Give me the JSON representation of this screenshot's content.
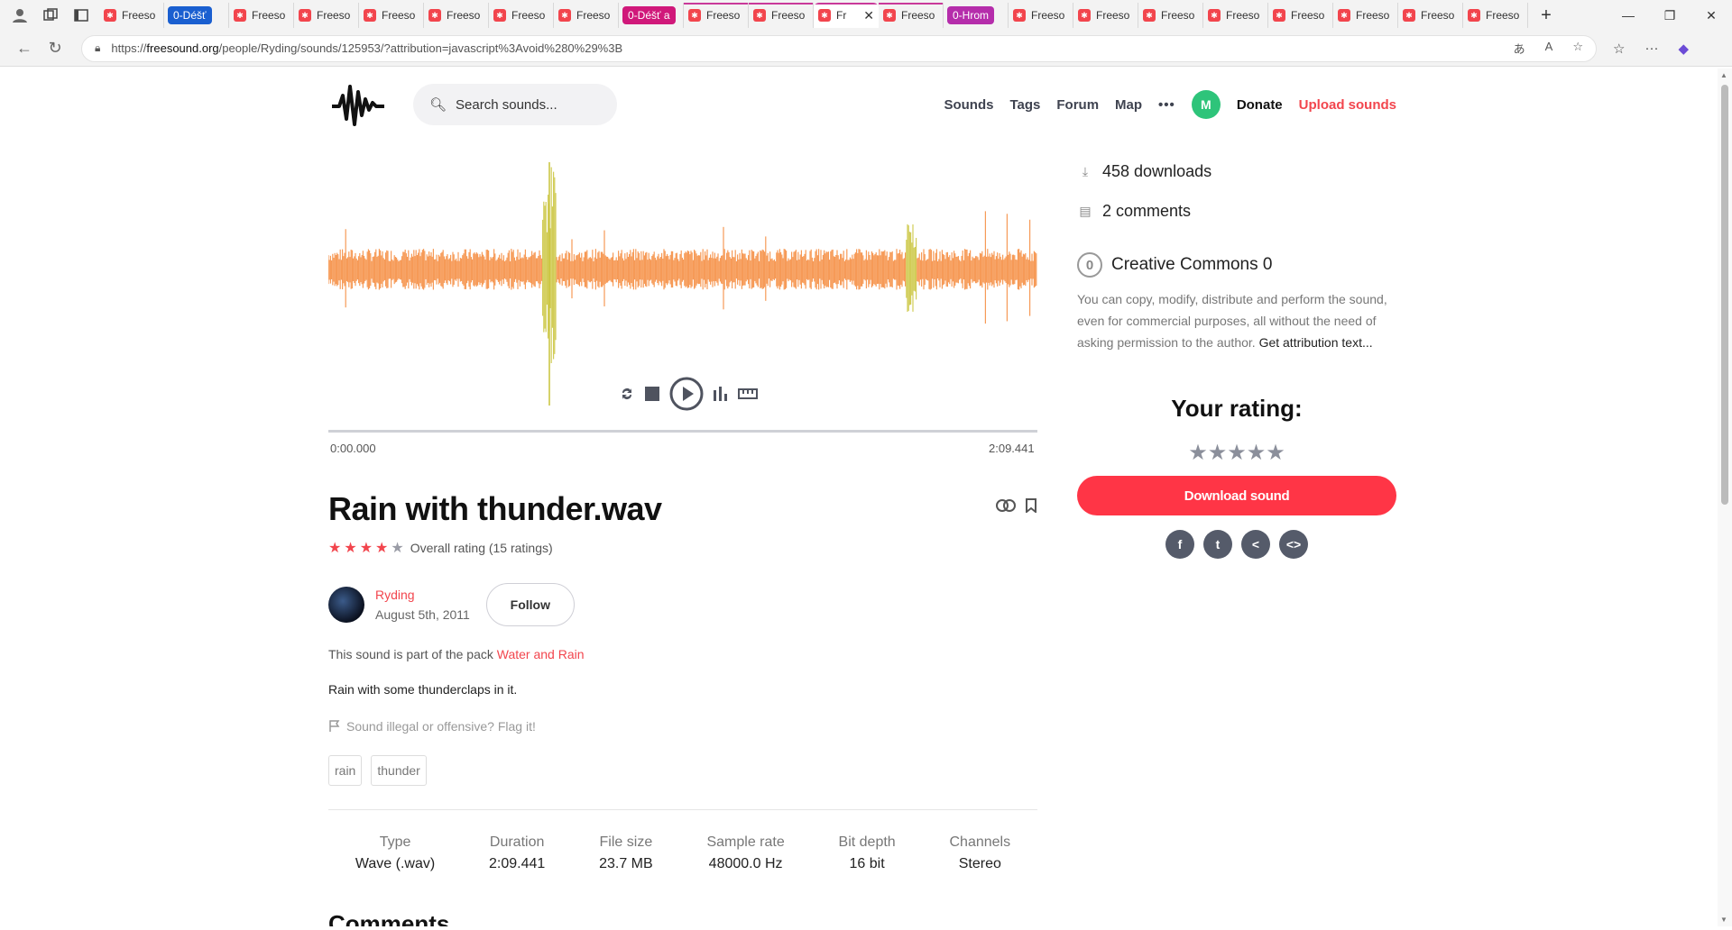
{
  "browser": {
    "tabs": [
      {
        "label": "Freeso",
        "kind": "site"
      },
      {
        "label": "0-Déšť",
        "kind": "group",
        "color": "#1a5fd0"
      },
      {
        "label": "Freeso",
        "kind": "site"
      },
      {
        "label": "Freeso",
        "kind": "site"
      },
      {
        "label": "Freeso",
        "kind": "site"
      },
      {
        "label": "Freeso",
        "kind": "site"
      },
      {
        "label": "Freeso",
        "kind": "site"
      },
      {
        "label": "Freeso",
        "kind": "site"
      },
      {
        "label": "0-Déšť a",
        "kind": "group",
        "color": "#d0187a"
      },
      {
        "label": "Freeso",
        "kind": "site"
      },
      {
        "label": "Freeso",
        "kind": "site"
      },
      {
        "label": "Fr",
        "kind": "active"
      },
      {
        "label": "Freeso",
        "kind": "site"
      },
      {
        "label": "0-Hrom",
        "kind": "group",
        "color": "#b52dab"
      },
      {
        "label": "Freeso",
        "kind": "site"
      },
      {
        "label": "Freeso",
        "kind": "site"
      },
      {
        "label": "Freeso",
        "kind": "site"
      },
      {
        "label": "Freeso",
        "kind": "site"
      },
      {
        "label": "Freeso",
        "kind": "site"
      },
      {
        "label": "Freeso",
        "kind": "site"
      },
      {
        "label": "Freeso",
        "kind": "site"
      },
      {
        "label": "Freeso",
        "kind": "site"
      }
    ],
    "url_prefix": "https://",
    "url_host": "freesound.org",
    "url_path": "/people/Ryding/sounds/125953/?attribution=javascript%3Avoid%280%29%3B"
  },
  "header": {
    "search_placeholder": "Search sounds...",
    "nav": [
      "Sounds",
      "Tags",
      "Forum",
      "Map"
    ],
    "avatar_letter": "M",
    "donate": "Donate",
    "upload": "Upload sounds"
  },
  "player": {
    "time_start": "0:00.000",
    "time_end": "2:09.441"
  },
  "sound": {
    "title": "Rain with thunder.wav",
    "rating_text": "Overall rating (15 ratings)",
    "rating_value": 4,
    "rating_max": 5,
    "user": "Ryding",
    "date": "August 5th, 2011",
    "follow": "Follow",
    "pack_prefix": "This sound is part of the pack ",
    "pack_name": "Water and Rain",
    "description": "Rain with some thunderclaps in it.",
    "flag": "Sound illegal or offensive? Flag it!",
    "tags": [
      "rain",
      "thunder"
    ],
    "meta": [
      {
        "k": "Type",
        "v": "Wave (.wav)"
      },
      {
        "k": "Duration",
        "v": "2:09.441"
      },
      {
        "k": "File size",
        "v": "23.7 MB"
      },
      {
        "k": "Sample rate",
        "v": "48000.0 Hz"
      },
      {
        "k": "Bit depth",
        "v": "16 bit"
      },
      {
        "k": "Channels",
        "v": "Stereo"
      }
    ],
    "comments_heading": "Comments"
  },
  "side": {
    "downloads": "458 downloads",
    "comments": "2 comments",
    "license": "Creative Commons 0",
    "license_text": "You can copy, modify, distribute and perform the sound, even for commercial purposes, all without the need of asking permission to the author. ",
    "license_link": "Get attribution text...",
    "your_rating": "Your rating:",
    "download": "Download sound"
  },
  "colors": {
    "accent": "#f2454d",
    "wave_orange": "#f5893a",
    "wave_yellow": "#c9c43a"
  }
}
